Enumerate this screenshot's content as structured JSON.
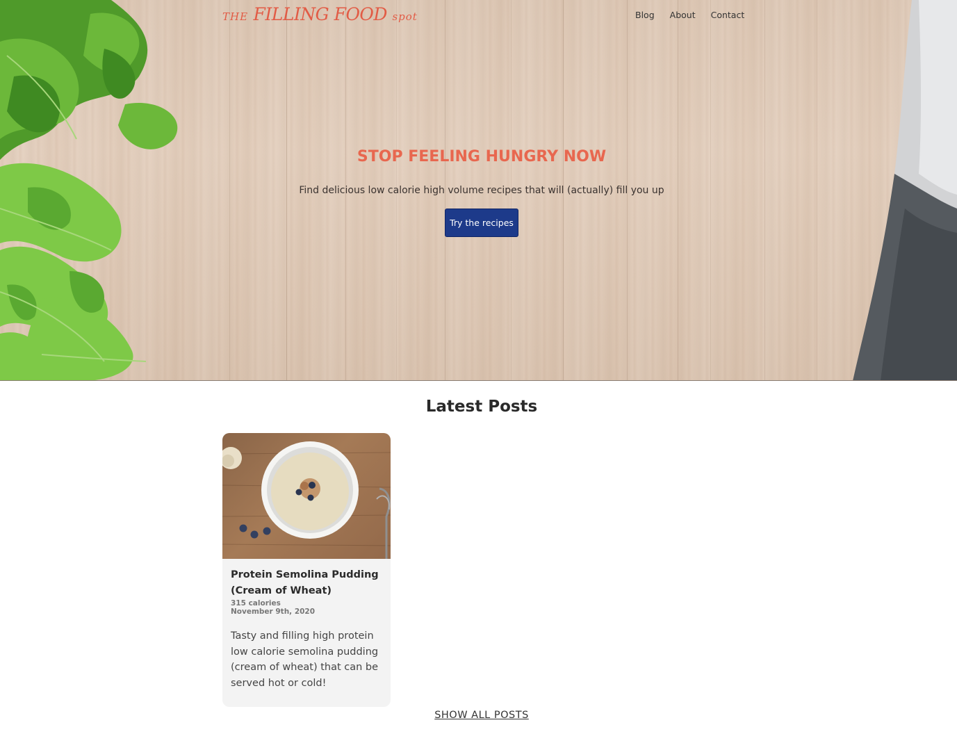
{
  "header": {
    "logo_prefix": "THE",
    "logo_main": "FILLING FOOD",
    "logo_suffix": "spot",
    "nav": [
      {
        "label": "Blog"
      },
      {
        "label": "About"
      },
      {
        "label": "Contact"
      }
    ]
  },
  "hero": {
    "title": "STOP FEELING HUNGRY NOW",
    "subtitle": "Find delicious low calorie high volume recipes that will (actually) fill you up",
    "button_label": "Try the recipes"
  },
  "latest": {
    "heading": "Latest Posts",
    "posts": [
      {
        "title": "Protein Semolina Pudding (Cream of Wheat)",
        "calories": "315 calories",
        "date": "November 9th, 2020",
        "excerpt": "Tasty and filling high protein low calorie semolina pudding (cream of wheat) that can be served hot or cold!"
      }
    ],
    "show_all_label": "SHOW ALL POSTS"
  },
  "colors": {
    "accent": "#e8674f",
    "button": "#1d3a8a",
    "card_bg": "#f3f3f3"
  }
}
